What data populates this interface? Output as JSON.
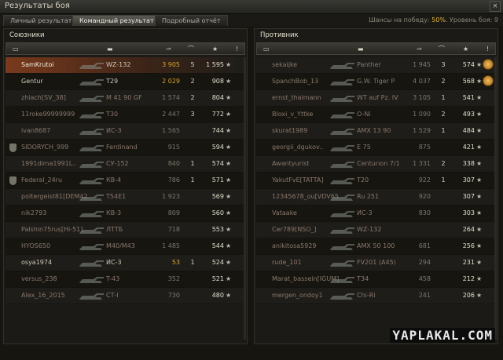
{
  "window": {
    "title": "Результаты боя",
    "close": "×"
  },
  "tabs": [
    {
      "label": "Личный результат",
      "active": false
    },
    {
      "label": "Командный результат",
      "active": true
    },
    {
      "label": "Подробный отчёт",
      "active": false
    }
  ],
  "chances": {
    "label": "Шансы на победу:",
    "value": "50%",
    "level_label": "Уровень боя:",
    "level": "9"
  },
  "allies": {
    "title": "Союзники",
    "columns": [
      "platoon-icon",
      "tank-icon",
      "damage-icon",
      "frags-icon",
      "experience-icon",
      "star-icon"
    ],
    "rows": [
      {
        "name": "SamKrutoi",
        "tank": "WZ-132",
        "damage": "3 905",
        "kills": "5",
        "xp": "1 595",
        "highlight": true,
        "dead": false,
        "clan_icon": false
      },
      {
        "name": "Gentur",
        "tank": "T29",
        "damage": "2 029",
        "kills": "2",
        "xp": "908",
        "highlight": false,
        "dead": false,
        "clan_icon": false
      },
      {
        "name": "zhiach[SV_38]",
        "tank": "M 41 90 GF",
        "damage": "1 574",
        "kills": "2",
        "xp": "804",
        "highlight": false,
        "dead": true,
        "clan_icon": false
      },
      {
        "name": "11roke99999999",
        "tank": "T30",
        "damage": "2 447",
        "kills": "3",
        "xp": "772",
        "highlight": false,
        "dead": true,
        "clan_icon": false
      },
      {
        "name": "ivan8687",
        "tank": "ИС-3",
        "damage": "1 565",
        "kills": "",
        "xp": "744",
        "highlight": false,
        "dead": true,
        "clan_icon": false
      },
      {
        "name": "SIDORYCH_999",
        "tank": "Ferdinand",
        "damage": "915",
        "kills": "",
        "xp": "594",
        "highlight": false,
        "dead": true,
        "clan_icon": true
      },
      {
        "name": "1991dima1991L..",
        "tank": "СУ-152",
        "damage": "840",
        "kills": "1",
        "xp": "574",
        "highlight": false,
        "dead": true,
        "clan_icon": false
      },
      {
        "name": "Federal_24ru",
        "tank": "КВ-4",
        "damage": "786",
        "kills": "1",
        "xp": "571",
        "highlight": false,
        "dead": true,
        "clan_icon": true
      },
      {
        "name": "poltergeist81[DEM42]",
        "tank": "T54E1",
        "damage": "1 923",
        "kills": "",
        "xp": "569",
        "highlight": false,
        "dead": true,
        "clan_icon": false
      },
      {
        "name": "nik2793",
        "tank": "КВ-3",
        "damage": "809",
        "kills": "",
        "xp": "560",
        "highlight": false,
        "dead": true,
        "clan_icon": false
      },
      {
        "name": "Palshin75rus[Hi-51]",
        "tank": "ЛТТБ",
        "damage": "718",
        "kills": "",
        "xp": "553",
        "highlight": false,
        "dead": true,
        "clan_icon": false
      },
      {
        "name": "HYOS650",
        "tank": "M40/M43",
        "damage": "1 485",
        "kills": "",
        "xp": "544",
        "highlight": false,
        "dead": true,
        "clan_icon": false
      },
      {
        "name": "osya1974",
        "tank": "ИС-3",
        "damage": "53",
        "kills": "1",
        "xp": "524",
        "highlight": false,
        "dead": false,
        "clan_icon": false
      },
      {
        "name": "versus_238",
        "tank": "T-43",
        "damage": "352",
        "kills": "",
        "xp": "521",
        "highlight": false,
        "dead": true,
        "clan_icon": false
      },
      {
        "name": "Alex_16_2015",
        "tank": "СТ-I",
        "damage": "730",
        "kills": "",
        "xp": "480",
        "highlight": false,
        "dead": true,
        "clan_icon": false
      }
    ]
  },
  "enemies": {
    "title": "Противник",
    "columns": [
      "platoon-icon",
      "tank-icon",
      "damage-icon",
      "frags-icon",
      "experience-icon",
      "star-icon"
    ],
    "rows": [
      {
        "name": "sekaijke",
        "tank": "Panther",
        "damage": "1 945",
        "kills": "3",
        "xp": "574",
        "medal": true,
        "dead": true
      },
      {
        "name": "SpanchBob_13",
        "tank": "G.W. Tiger P",
        "damage": "4 037",
        "kills": "2",
        "xp": "568",
        "medal": true,
        "dead": true
      },
      {
        "name": "ernst_thalmann",
        "tank": "WT auf Pz. IV",
        "damage": "3 105",
        "kills": "1",
        "xp": "541",
        "medal": false,
        "dead": true
      },
      {
        "name": "Bloxi_v_Yttke",
        "tank": "O-Ni",
        "damage": "1 090",
        "kills": "2",
        "xp": "493",
        "medal": false,
        "dead": true
      },
      {
        "name": "skurat1989",
        "tank": "AMX 13 90",
        "damage": "1 529",
        "kills": "1",
        "xp": "484",
        "medal": false,
        "dead": true
      },
      {
        "name": "georgii_dgukov..",
        "tank": "E 75",
        "damage": "875",
        "kills": "",
        "xp": "421",
        "medal": false,
        "dead": true
      },
      {
        "name": "Awantyurist",
        "tank": "Centurion 7/1",
        "damage": "1 331",
        "kills": "2",
        "xp": "338",
        "medal": false,
        "dead": true
      },
      {
        "name": "YakutFvE[TATTA]",
        "tank": "T20",
        "damage": "922",
        "kills": "1",
        "xp": "307",
        "medal": false,
        "dead": true
      },
      {
        "name": "12345678_ou[VDV65]",
        "tank": "Ru 251",
        "damage": "920",
        "kills": "",
        "xp": "307",
        "medal": false,
        "dead": true
      },
      {
        "name": "Vataake",
        "tank": "ИС-3",
        "damage": "830",
        "kills": "",
        "xp": "303",
        "medal": false,
        "dead": true
      },
      {
        "name": "Cer789[NSO_]",
        "tank": "WZ-132",
        "damage": "",
        "kills": "",
        "xp": "264",
        "medal": false,
        "dead": true
      },
      {
        "name": "anikitosa5929",
        "tank": "AMX 50 100",
        "damage": "681",
        "kills": "",
        "xp": "256",
        "medal": false,
        "dead": true
      },
      {
        "name": "rude_101",
        "tank": "FV201 (A45)",
        "damage": "294",
        "kills": "",
        "xp": "231",
        "medal": false,
        "dead": true
      },
      {
        "name": "Marat_bassein[IGUM]",
        "tank": "T34",
        "damage": "458",
        "kills": "",
        "xp": "212",
        "medal": false,
        "dead": true
      },
      {
        "name": "mergen_ondoy1",
        "tank": "Chi-Ri",
        "damage": "241",
        "kills": "",
        "xp": "206",
        "medal": false,
        "dead": true
      }
    ]
  },
  "watermark": "YAPLAKAL.COM",
  "colors": {
    "highlight": "#7a3a1d",
    "gold": "#d7a330",
    "accent": "#e6b43a"
  }
}
